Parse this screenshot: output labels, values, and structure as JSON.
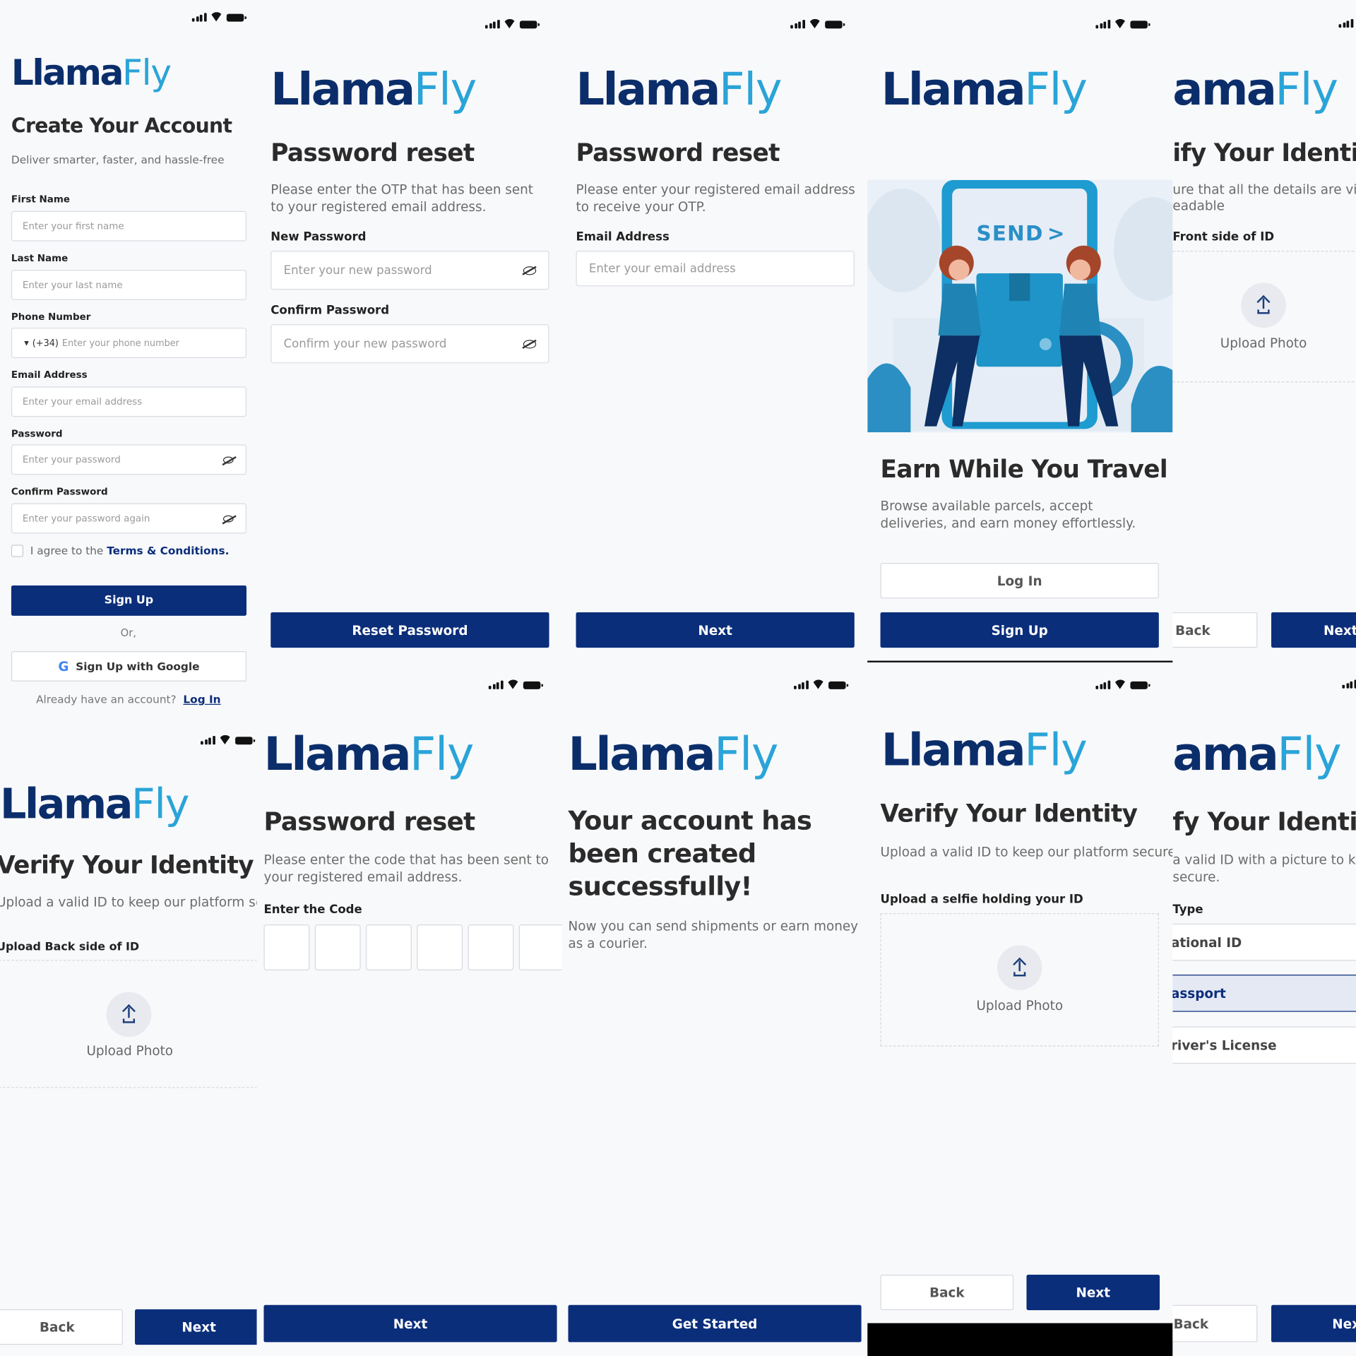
{
  "logo": {
    "part1": "Llama",
    "part2": "Fly"
  },
  "logo_crop": {
    "part1": "ama",
    "part2": "Fly"
  },
  "colors": {
    "primary": "#0b2e7b",
    "logo_dark": "#0b2e6b",
    "logo_light": "#2aa4d8",
    "background": "#f8f9fb"
  },
  "create_account": {
    "title": "Create Your Account",
    "subtitle": "Deliver smarter, faster, and hassle-free",
    "first_name_label": "First Name",
    "first_name_placeholder": "Enter your first name",
    "last_name_label": "Last Name",
    "last_name_placeholder": "Enter your last name",
    "phone_label": "Phone Number",
    "phone_code": "(+34)",
    "phone_placeholder": "Enter your phone number",
    "email_label": "Email Address",
    "email_placeholder": "Enter your email address",
    "password_label": "Password",
    "password_placeholder": "Enter your password",
    "confirm_label": "Confirm Password",
    "confirm_placeholder": "Enter your password again",
    "agree_text": "I agree to the",
    "terms_link": "Terms & Conditions.",
    "signup_button": "Sign Up",
    "or_text": "Or,",
    "google_button": "Sign Up with Google",
    "have_account": "Already have an account?",
    "login_link": "Log In"
  },
  "reset_new": {
    "title": "Password reset",
    "subtitle": "Please enter the OTP that has been sent to your registered email address.",
    "new_label": "New Password",
    "new_placeholder": "Enter your new password",
    "confirm_label": "Confirm Password",
    "confirm_placeholder": "Confirm your new password",
    "button": "Reset Password"
  },
  "reset_email": {
    "title": "Password reset",
    "subtitle": "Please enter your registered email address to receive your OTP.",
    "email_label": "Email Address",
    "email_placeholder": "Enter your email address",
    "button": "Next"
  },
  "onboarding": {
    "send_text": "SEND",
    "title": "Earn While You Travel",
    "subtitle": "Browse available parcels, accept deliveries, and earn money effortlessly.",
    "login_button": "Log In",
    "signup_button": "Sign Up"
  },
  "verify_front": {
    "title": "ify Your Identity",
    "subtitle_l1": "ure that all the details are visib",
    "subtitle_l2": "eadable",
    "label": "Front side of ID",
    "upload": "Upload Photo",
    "back_button": "Back",
    "next_button": "Next"
  },
  "verify_back": {
    "title": "Verify Your Identity",
    "subtitle": "Upload a valid ID to keep our platform secure.",
    "label": "Upload Back side of ID",
    "upload": "Upload Photo",
    "back_button": "Back",
    "next_button": "Next"
  },
  "reset_code": {
    "title": "Password reset",
    "subtitle": "Please enter the code that has been sent to your registered email address.",
    "code_label": "Enter the Code",
    "button": "Next"
  },
  "success": {
    "title_l1": "Your account has",
    "title_l2": "been created",
    "title_l3": "successfully!",
    "subtitle": "Now you can send shipments or earn money as a courier.",
    "button": "Get Started"
  },
  "verify_selfie": {
    "title": "Verify Your Identity",
    "subtitle": "Upload a valid ID to keep our platform secure.",
    "label": "Upload a selfie holding your ID",
    "upload": "Upload Photo",
    "back_button": "Back",
    "next_button": "Next"
  },
  "verify_type": {
    "title": "fy Your Identit",
    "subtitle_l1": "a valid ID with a picture to kee",
    "subtitle_l2": "secure.",
    "label": "Type",
    "options": [
      "ational ID",
      "assport",
      "river's License"
    ],
    "selected_index": 1,
    "back_button": "Back",
    "next_button": "Next"
  }
}
